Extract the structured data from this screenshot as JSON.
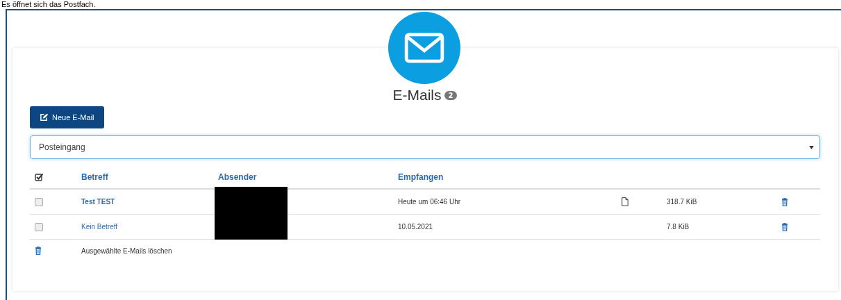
{
  "caption": "Es öffnet sich das Postfach.",
  "title": "E-Mails",
  "count": "2",
  "new_button": "Neue E-Mail",
  "folder_select": {
    "value": "Posteingang"
  },
  "table": {
    "select_all_checked": true,
    "sender_redacted": true,
    "columns": [
      "Betreff",
      "Absender",
      "Empfangen"
    ],
    "rows": [
      {
        "checked": false,
        "subject": "Test TEST",
        "unread": true,
        "received": "Heute um 06:46 Uhr",
        "attachment": true,
        "size": "318.7 KiB"
      },
      {
        "checked": false,
        "subject": "Kein Betreff",
        "unread": false,
        "received": "10.05.2021",
        "attachment": false,
        "size": "7.8 KiB"
      }
    ]
  },
  "delete_selected": "Ausgewählte E-Mails löschen"
}
